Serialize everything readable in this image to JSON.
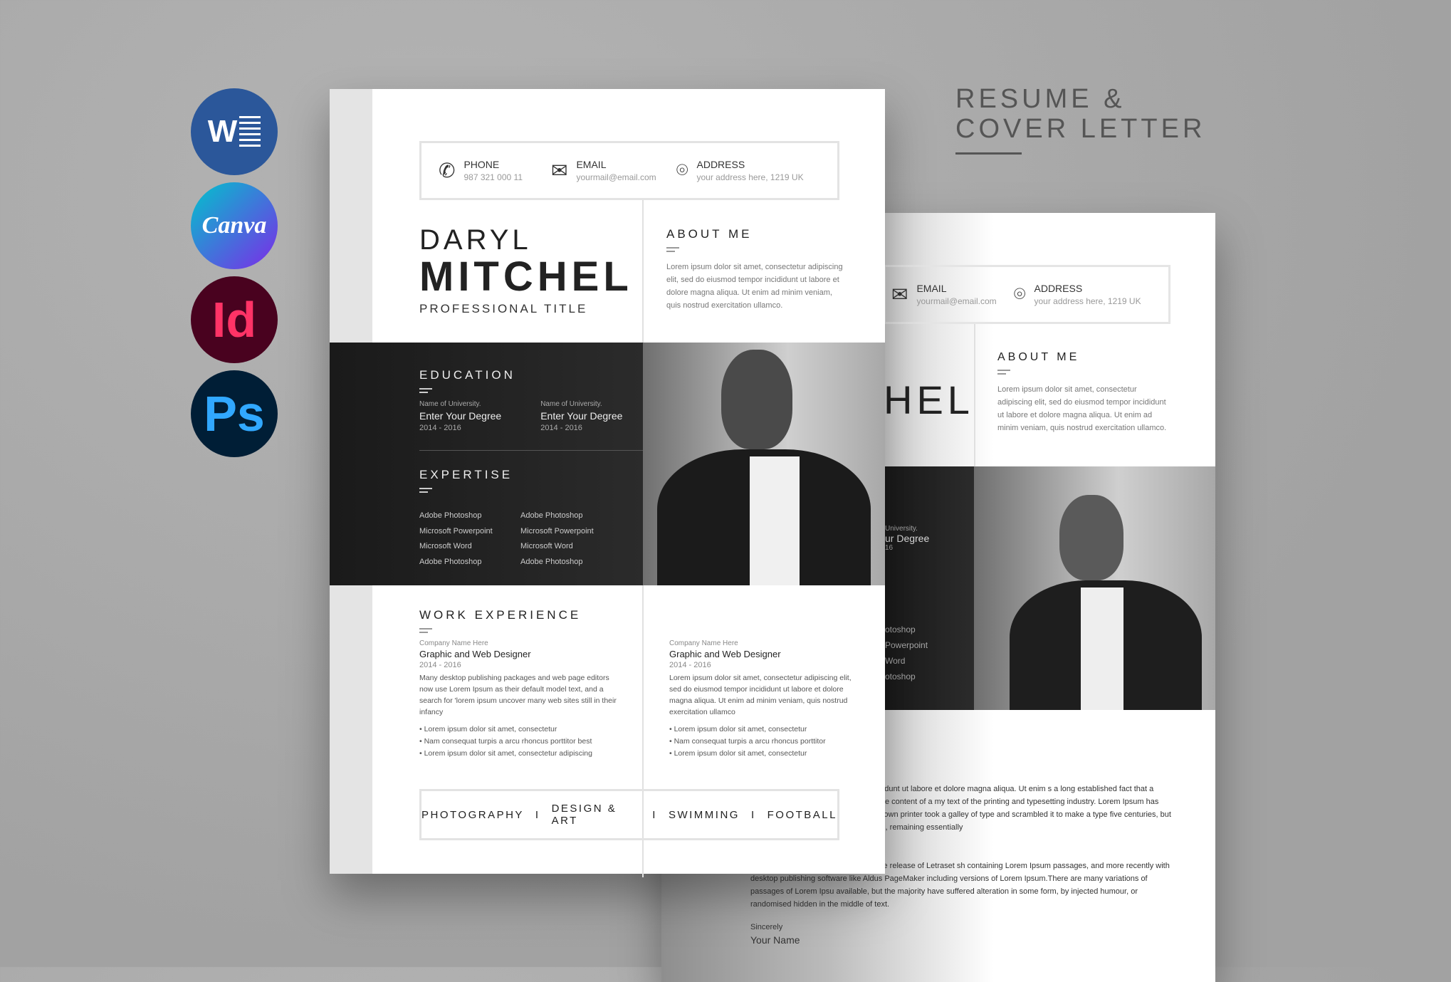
{
  "heading": {
    "line1": "RESUME &",
    "line2": "COVER LETTER"
  },
  "apps": [
    {
      "name": "word",
      "label": "W",
      "color": "#2b579a"
    },
    {
      "name": "canva",
      "label": "Canva",
      "color": "#7d2ae8"
    },
    {
      "name": "indesign",
      "label": "Id",
      "color": "#49021f"
    },
    {
      "name": "photoshop",
      "label": "Ps",
      "color": "#001e36"
    }
  ],
  "contact": {
    "phone_label": "PHONE",
    "phone": "987 321 000 11",
    "email_label": "EMAIL",
    "email": "yourmail@email.com",
    "address_label": "ADDRESS",
    "address": "your address here, 1219 UK"
  },
  "name": {
    "first": "DARYL",
    "last": "MITCHEL",
    "title": "PROFESSIONAL TITLE"
  },
  "about": {
    "heading": "ABOUT ME",
    "text": "Lorem ipsum dolor sit amet, consectetur adipiscing elit, sed do eiusmod tempor incididunt ut labore et dolore magna aliqua. Ut enim ad minim veniam, quis nostrud exercitation ullamco."
  },
  "education": {
    "heading": "EDUCATION",
    "items": [
      {
        "school": "Name of University.",
        "degree": "Enter Your Degree",
        "years": "2014 - 2016"
      },
      {
        "school": "Name of University.",
        "degree": "Enter Your Degree",
        "years": "2014 - 2016"
      }
    ]
  },
  "expertise": {
    "heading": "EXPERTISE",
    "col1": [
      "Adobe Photoshop",
      "Microsoft Powerpoint",
      "Microsoft Word",
      "Adobe Photoshop"
    ],
    "col2": [
      "Adobe Photoshop",
      "Microsoft Powerpoint",
      "Microsoft Word",
      "Adobe Photoshop"
    ]
  },
  "work": {
    "heading": "WORK EXPERIENCE",
    "jobs": [
      {
        "company": "Company Name Here",
        "role": "Graphic and Web Designer",
        "years": "2014 - 2016",
        "text": "Many desktop publishing packages and web page editors now use Lorem Ipsum as their default model text, and a search for 'lorem ipsum uncover many web sites still in their infancy",
        "bullets": [
          "Lorem ipsum dolor sit amet, consectetur",
          "Nam consequat turpis a arcu rhoncus porttitor best",
          "Lorem ipsum dolor sit amet, consectetur adipiscing"
        ]
      },
      {
        "company": "Company Name Here",
        "role": "Graphic and Web Designer",
        "years": "2014 - 2016",
        "text": "Lorem ipsum dolor sit amet, consectetur adipiscing elit, sed do eiusmod tempor incididunt ut labore et dolore magna aliqua. Ut enim ad minim veniam, quis nostrud exercitation ullamco",
        "bullets": [
          "Lorem ipsum dolor sit amet, consectetur",
          "Nam consequat turpis a arcu rhoncus porttitor",
          "Lorem ipsum dolor sit amet, consectetur"
        ]
      }
    ]
  },
  "hobbies": [
    "PHOTOGRAPHY",
    "DESIGN & ART",
    "SWIMMING",
    "FOOTBALL"
  ],
  "hobby_sep": "I",
  "back": {
    "name_fragment": "HEL",
    "edu_fragment1": "University.",
    "edu_fragment2": "ur Degree",
    "edu_fragment3": "16",
    "exp_fragments": [
      "otoshop",
      "Powerpoint",
      "Word",
      "otoshop"
    ],
    "para1": "piscing elit, sed do eiusm tempor incididunt ut labore et dolore magna aliqua. Ut enim s a long established fact that a reader will be distracted by the readable content of a my text of the printing and typesetting industry. Lorem Ipsum has been the industry's 00s, when an unknown printer took a galley of type and scrambled it to make a type five centuries, but also the leap into electronic typesetting, remaining essentially",
    "para2": "It was popularised in the 1960s with the release of Letraset sh containing Lorem Ipsum passages, and more recently with desktop publishing software like Aldus PageMaker including versions of Lorem Ipsum.There are many variations of passages of Lorem Ipsu available, but the majority have suffered alteration in some form, by injected humour, or randomised  hidden in the middle of text.",
    "closing": "Sincerely",
    "signature": "Your Name"
  }
}
